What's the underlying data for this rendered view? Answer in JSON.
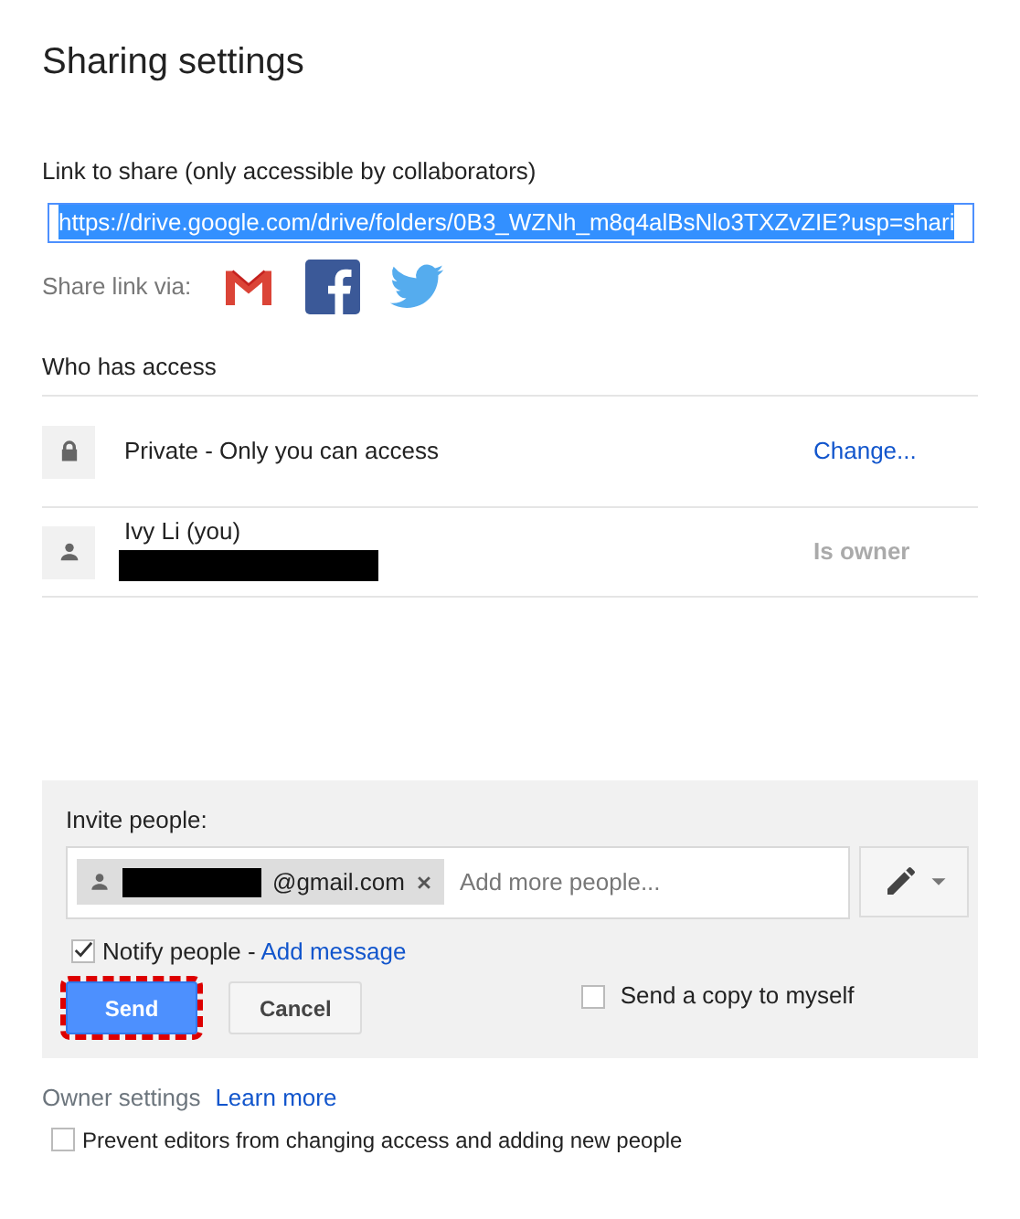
{
  "window": {
    "title": "Sharing settings"
  },
  "link_share": {
    "label": "Link to share (only accessible by collaborators)",
    "value": "https://drive.google.com/drive/folders/0B3_WZNh_m8q4alBsNlo3TXZvZIE?usp=shari",
    "selected": true
  },
  "share_via": {
    "label": "Share link via:",
    "services": [
      {
        "kind": "gmail"
      },
      {
        "kind": "facebook"
      },
      {
        "kind": "twitter"
      }
    ]
  },
  "access": {
    "heading": "Who has access",
    "rows": [
      {
        "kind": "lock",
        "name": "Private - Only you can access",
        "action": "Change...",
        "redacted": false
      },
      {
        "kind": "person",
        "name": "Ivy Li (you)",
        "action": "Is owner",
        "redacted": true
      }
    ]
  },
  "invite": {
    "label": "Invite people:",
    "chips": [
      {
        "text": "@gmail.com",
        "redacted": true
      }
    ],
    "placeholder": "Add more people...",
    "notify": {
      "label": "Notify people - ",
      "link": "Add message",
      "checked": true
    },
    "buttons": [
      {
        "kind": "primary",
        "label": "Send",
        "highlighted": true
      },
      {
        "kind": "secondary",
        "label": "Cancel",
        "highlighted": false
      }
    ],
    "copy_to_myself": {
      "label": "Send a copy to myself",
      "checked": false
    }
  },
  "owner_settings": {
    "label": "Owner settings",
    "link": "Learn more",
    "prevent": {
      "label": "Prevent editors from changing access and adding new people",
      "checked": false
    }
  }
}
